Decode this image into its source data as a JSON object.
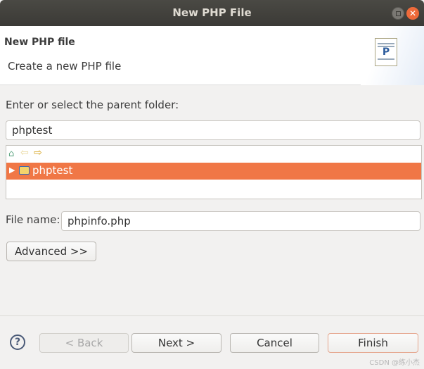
{
  "window": {
    "title": "New PHP File"
  },
  "header": {
    "title": "New PHP file",
    "description": "Create a new PHP file",
    "icon": "php-file-icon"
  },
  "folder": {
    "label": "Enter or select the parent folder:",
    "value": "phptest"
  },
  "tree": {
    "items": [
      {
        "label": "phptest",
        "selected": true,
        "icon": "project-folder-icon"
      }
    ],
    "selection_color": "#f07746"
  },
  "file": {
    "label": "File name:",
    "value": "phpinfo.php"
  },
  "advanced_label": "Advanced >>",
  "buttons": {
    "back": "< Back",
    "next": "Next >",
    "cancel": "Cancel",
    "finish": "Finish"
  },
  "watermark": "CSDN @练小杰"
}
